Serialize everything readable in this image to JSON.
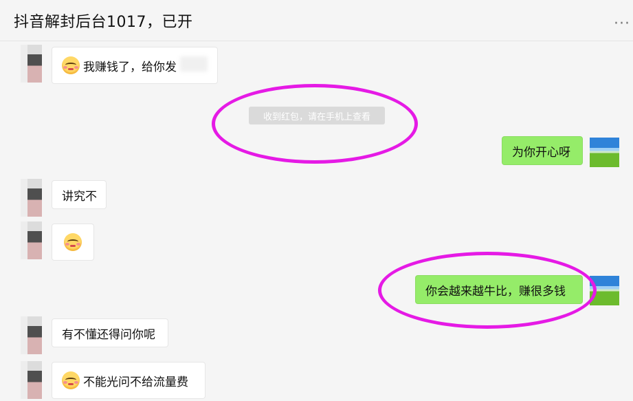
{
  "header": {
    "title": "抖音解封后台1017，已开",
    "more_icon": "···"
  },
  "messages": [
    {
      "side": "left",
      "text": "我赚钱了，给你发",
      "emoji": "flushed-smile-emoji"
    },
    {
      "side": "system",
      "text": "收到红包，请在手机上查看"
    },
    {
      "side": "right",
      "text": "为你开心呀"
    },
    {
      "side": "left",
      "text": "讲究不"
    },
    {
      "side": "left",
      "emoji": "flushed-smile-emoji"
    },
    {
      "side": "right",
      "text": "你会越来越牛比，赚很多钱"
    },
    {
      "side": "left",
      "text": "有不懂还得问你呢"
    },
    {
      "side": "left",
      "text": "不能光问不给流量费",
      "emoji": "flushed-smile-emoji"
    }
  ],
  "colors": {
    "bubble_me": "#95ec69",
    "bubble_other": "#ffffff",
    "annotation_ring": "#e51ae5",
    "background": "#f5f5f5"
  }
}
